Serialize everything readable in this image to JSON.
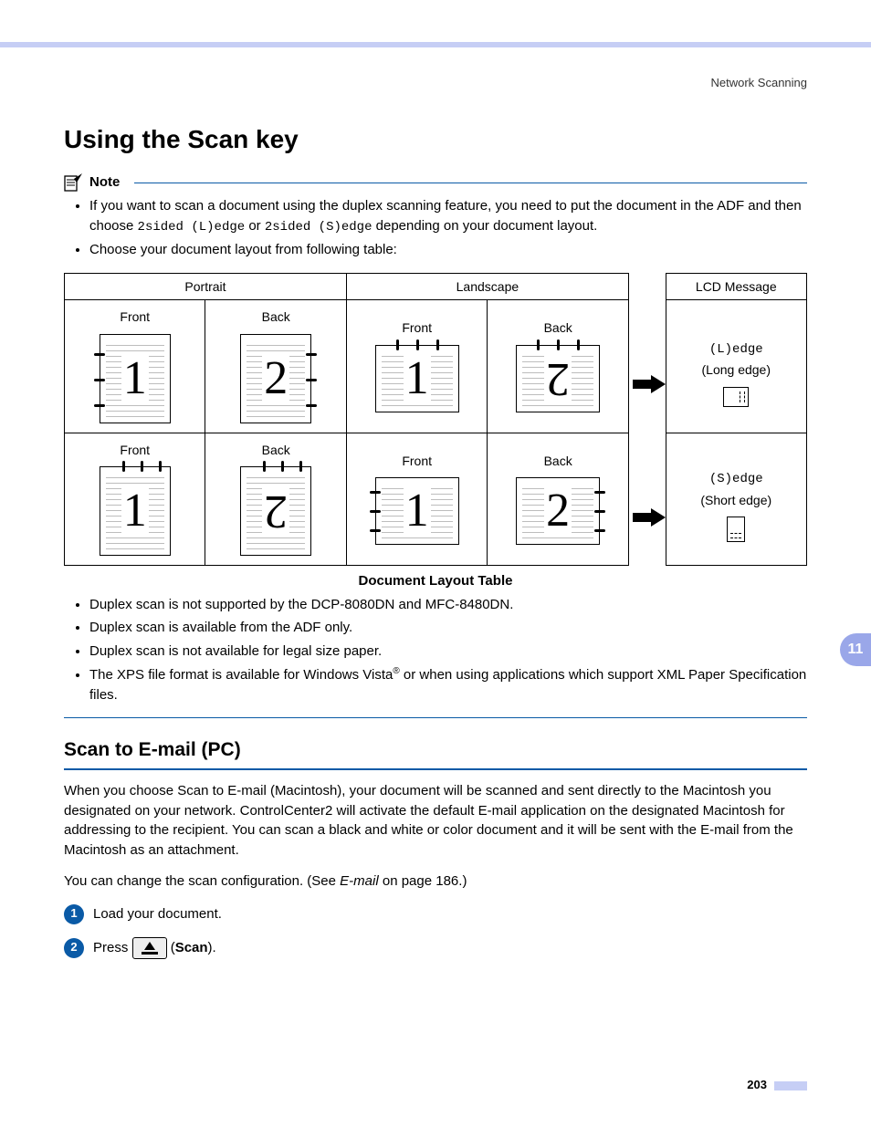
{
  "header": {
    "section": "Network Scanning"
  },
  "title": "Using the Scan key",
  "note": {
    "label": "Note",
    "items": [
      {
        "prefix": "If you want to scan a document using the duplex scanning feature, you need to put the document in the ADF and then choose ",
        "mono1": "2sided (L)edge",
        "mid": " or ",
        "mono2": "2sided (S)edge",
        "suffix": " depending on your document layout."
      },
      {
        "text": "Choose your document layout from following table:"
      }
    ]
  },
  "table": {
    "headers": {
      "portrait": "Portrait",
      "landscape": "Landscape",
      "lcd": "LCD Message"
    },
    "front": "Front",
    "back": "Back",
    "caption": "Document Layout Table",
    "chart_data": {
      "type": "table",
      "rows": [
        {
          "portrait_front": "1",
          "portrait_back": "2",
          "portrait_binding": "left-right",
          "landscape_front": "1",
          "landscape_back": "2-rotated",
          "landscape_binding": "top",
          "lcd_mono": "(L)edge",
          "lcd_text": "(Long edge)"
        },
        {
          "portrait_front": "1",
          "portrait_back": "2-rotated",
          "portrait_binding": "top",
          "landscape_front": "1",
          "landscape_back": "2",
          "landscape_binding": "left-right",
          "lcd_mono": "(S)edge",
          "lcd_text": "(Short edge)"
        }
      ]
    }
  },
  "bullets_after": [
    "Duplex scan is not supported by the DCP-8080DN and MFC-8480DN.",
    "Duplex scan is available from the ADF only.",
    "Duplex scan is not available for legal size paper.",
    {
      "prefix": "The XPS file format is available for Windows Vista",
      "sup": "®",
      "suffix": " or when using applications which support XML Paper Specification files."
    }
  ],
  "section2": {
    "heading": "Scan to E-mail (PC)",
    "para1": "When you choose Scan to E-mail (Macintosh), your document will be scanned and sent directly to the Macintosh you designated on your network. ControlCenter2 will activate the default E-mail application on the designated Macintosh for addressing to the recipient. You can scan a black and white or color document and it will be sent with the E-mail from the Macintosh as an attachment.",
    "para2_prefix": "You can change the scan configuration. (See ",
    "para2_link": "E-mail",
    "para2_suffix": " on page 186.)",
    "steps": [
      {
        "num": "1",
        "text": "Load your document."
      },
      {
        "num": "2",
        "prefix": "Press ",
        "button": "Scan",
        "suffix_open": " (",
        "suffix_close": ")."
      }
    ]
  },
  "chapter_tab": "11",
  "page_number": "203"
}
